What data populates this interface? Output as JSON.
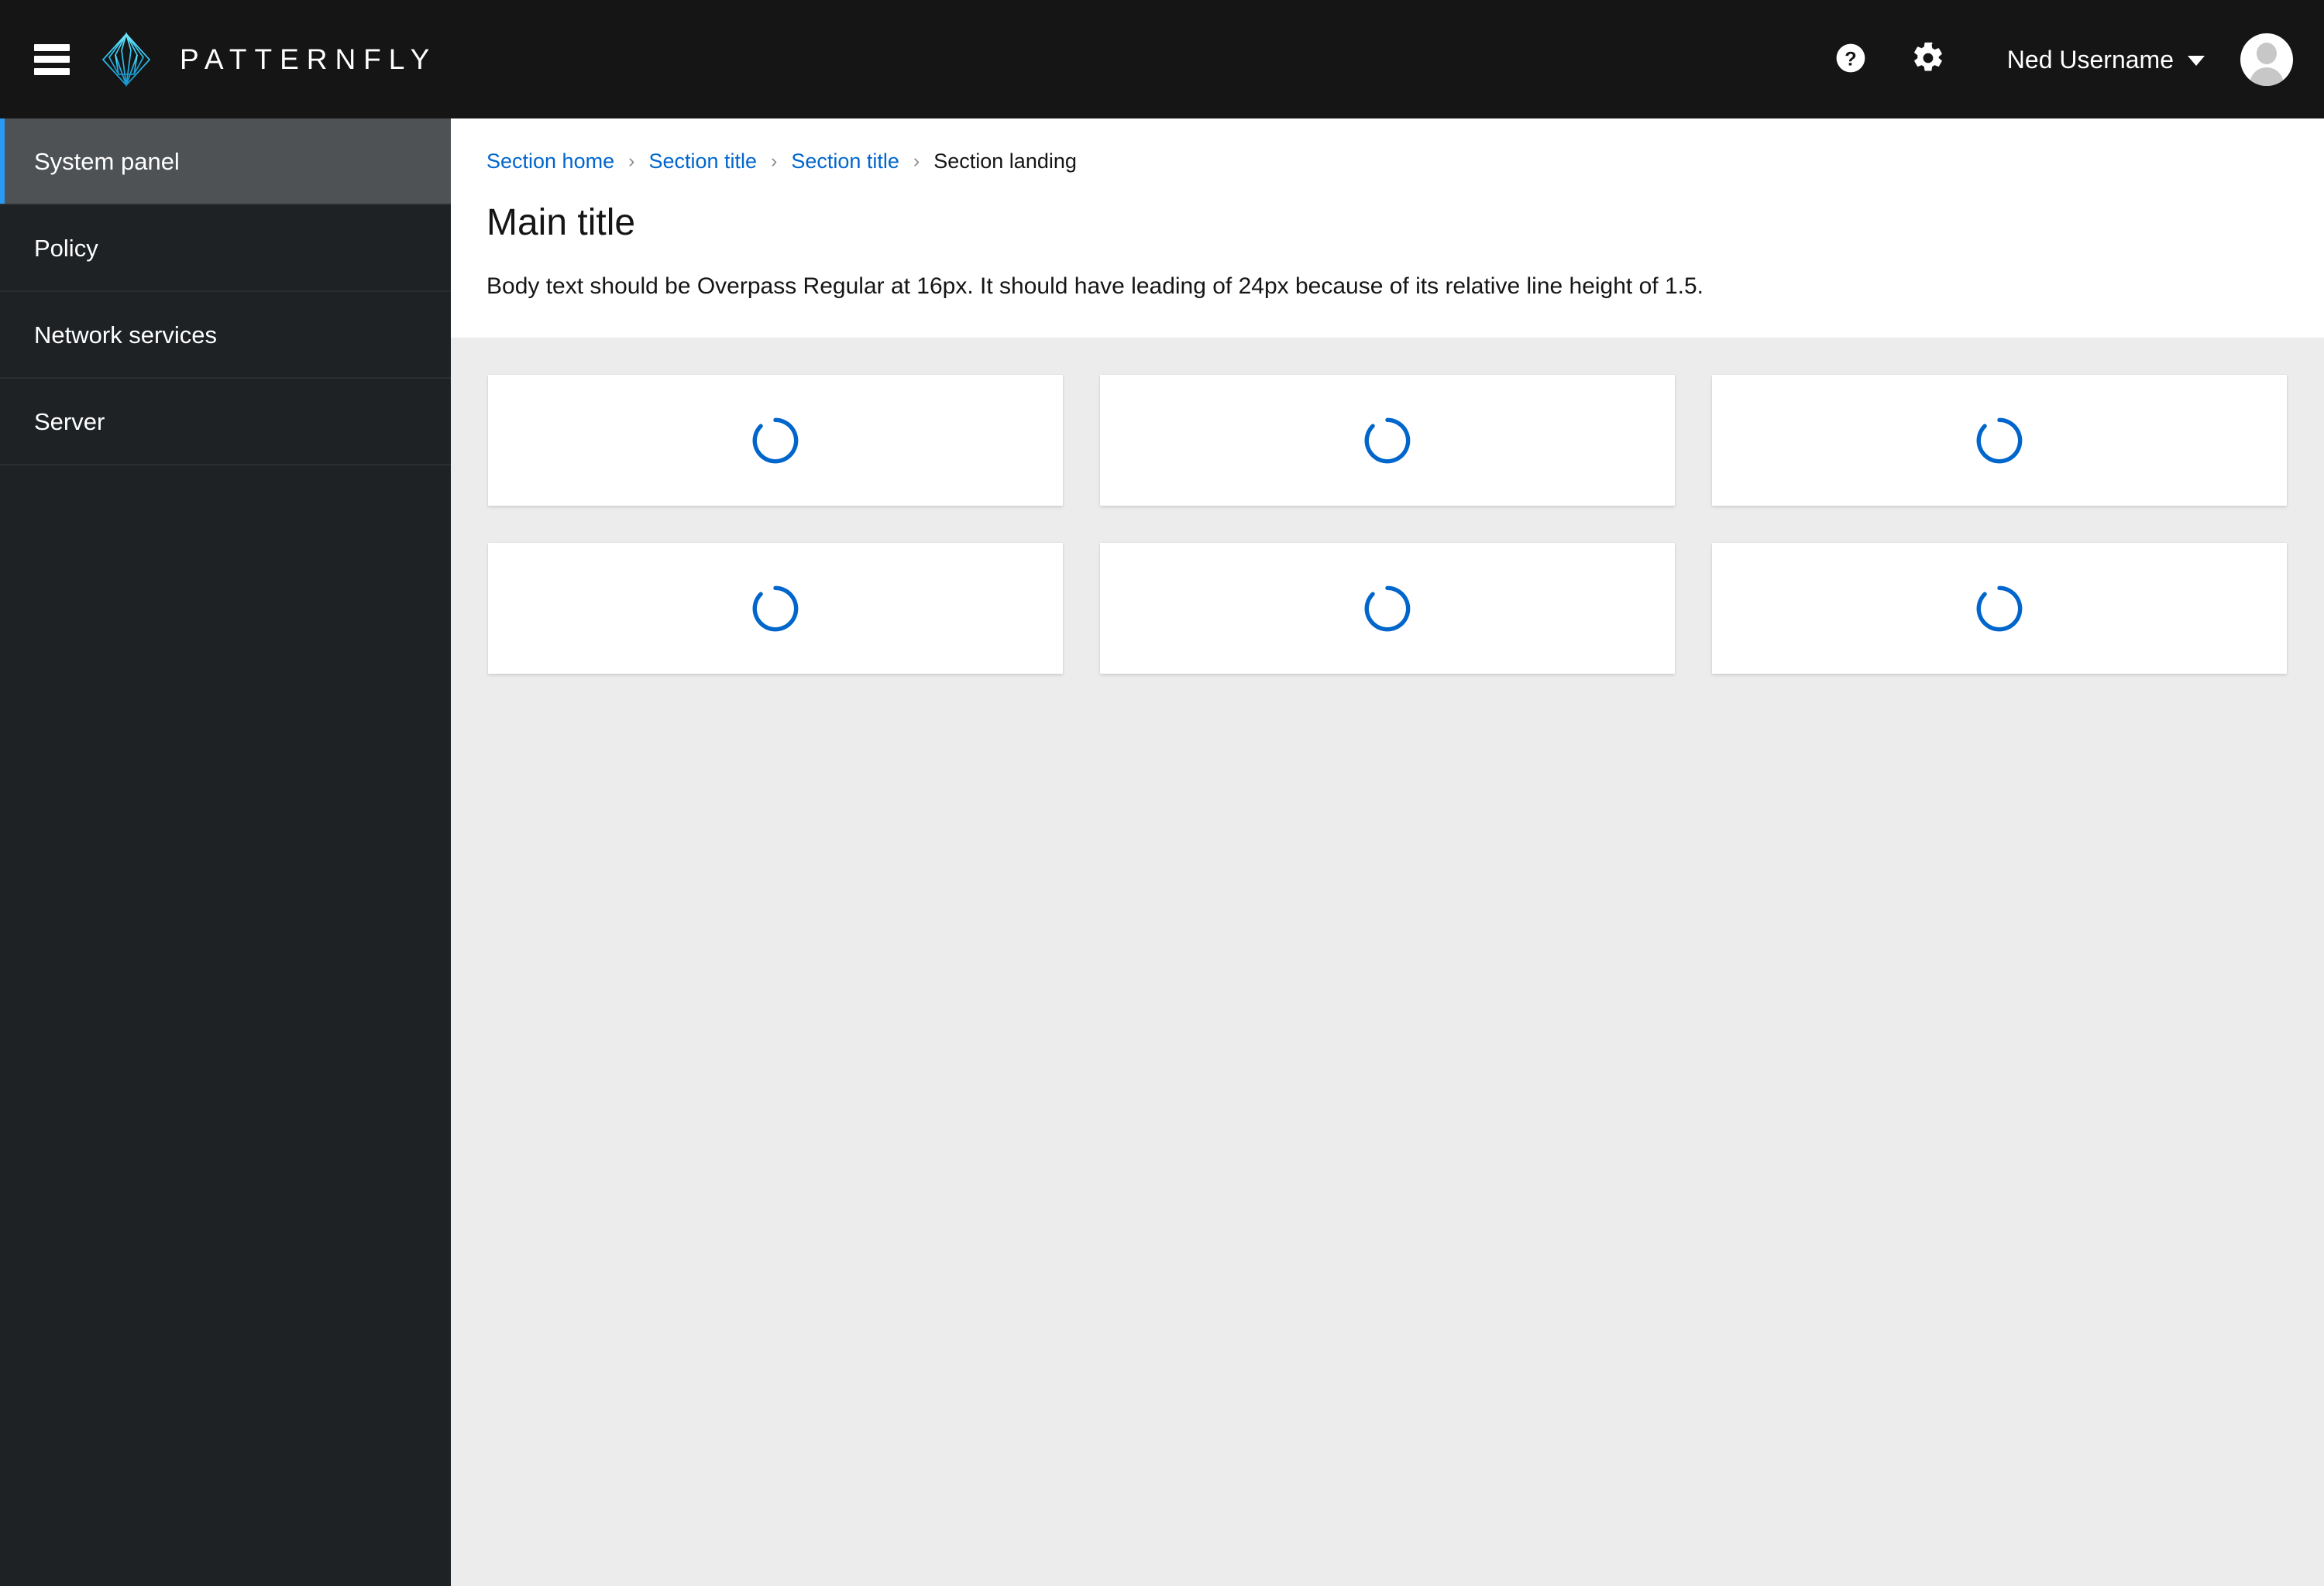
{
  "masthead": {
    "toggle_label": "Global navigation toggle",
    "brand_text": "PATTERNFLY",
    "help_label": "Help",
    "settings_label": "Settings",
    "user_name": "Ned Username",
    "accent_color": "#06c",
    "background_color": "#151515"
  },
  "sidebar": {
    "items": [
      {
        "label": "System panel",
        "active": true
      },
      {
        "label": "Policy",
        "active": false
      },
      {
        "label": "Network services",
        "active": false
      },
      {
        "label": "Server",
        "active": false
      }
    ],
    "active_accent_color": "#2b9af3",
    "background_color": "#1f2225"
  },
  "breadcrumb": {
    "separator": "›",
    "items": [
      {
        "label": "Section home",
        "current": false
      },
      {
        "label": "Section title",
        "current": false
      },
      {
        "label": "Section title",
        "current": false
      },
      {
        "label": "Section landing",
        "current": true
      }
    ]
  },
  "page": {
    "title": "Main title",
    "body_text": "Body text should be Overpass Regular at 16px. It should have leading of 24px because of its relative line height of 1.5."
  },
  "cards": [
    {
      "status": "loading",
      "spinner_label": "Loading..."
    },
    {
      "status": "loading",
      "spinner_label": "Loading..."
    },
    {
      "status": "loading",
      "spinner_label": "Loading..."
    },
    {
      "status": "loading",
      "spinner_label": "Loading..."
    },
    {
      "status": "loading",
      "spinner_label": "Loading..."
    },
    {
      "status": "loading",
      "spinner_label": "Loading..."
    }
  ],
  "colors": {
    "content_background": "#ececec",
    "card_background": "#ffffff",
    "spinner": "#06c",
    "link": "#06c"
  }
}
